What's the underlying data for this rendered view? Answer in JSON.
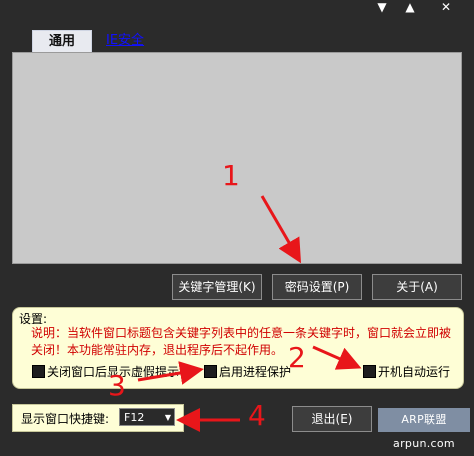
{
  "titlebar": {
    "min_icon": "▼",
    "max_icon": "▲",
    "close_icon": "✕"
  },
  "tabs": [
    {
      "label": "通用"
    },
    {
      "label": "IE安全"
    }
  ],
  "buttons": {
    "keyword_manage": "关键字管理(K)",
    "password_settings": "密码设置(P)",
    "about": "关于(A)",
    "exit": "退出(E)"
  },
  "settings": {
    "title": "设置:",
    "description": "说明：当软件窗口标题包含关键字列表中的任意一条关键字时，窗口就会立即被关闭！本功能常驻内存，退出程序后不起作用。",
    "options": [
      {
        "label": "关闭窗口后显示虚假提示",
        "checked": false
      },
      {
        "label": "启用进程保护",
        "checked": false
      },
      {
        "label": "开机自动运行",
        "checked": false
      }
    ]
  },
  "hotkey": {
    "label": "显示窗口快捷键:",
    "value": "F12"
  },
  "watermark": "ARP联盟 arpun.com",
  "annotations": [
    "1",
    "2",
    "3",
    "4"
  ],
  "colors": {
    "annotation": "#e8161a",
    "description_text": "#d00000",
    "settings_bg": "#fefed6"
  }
}
